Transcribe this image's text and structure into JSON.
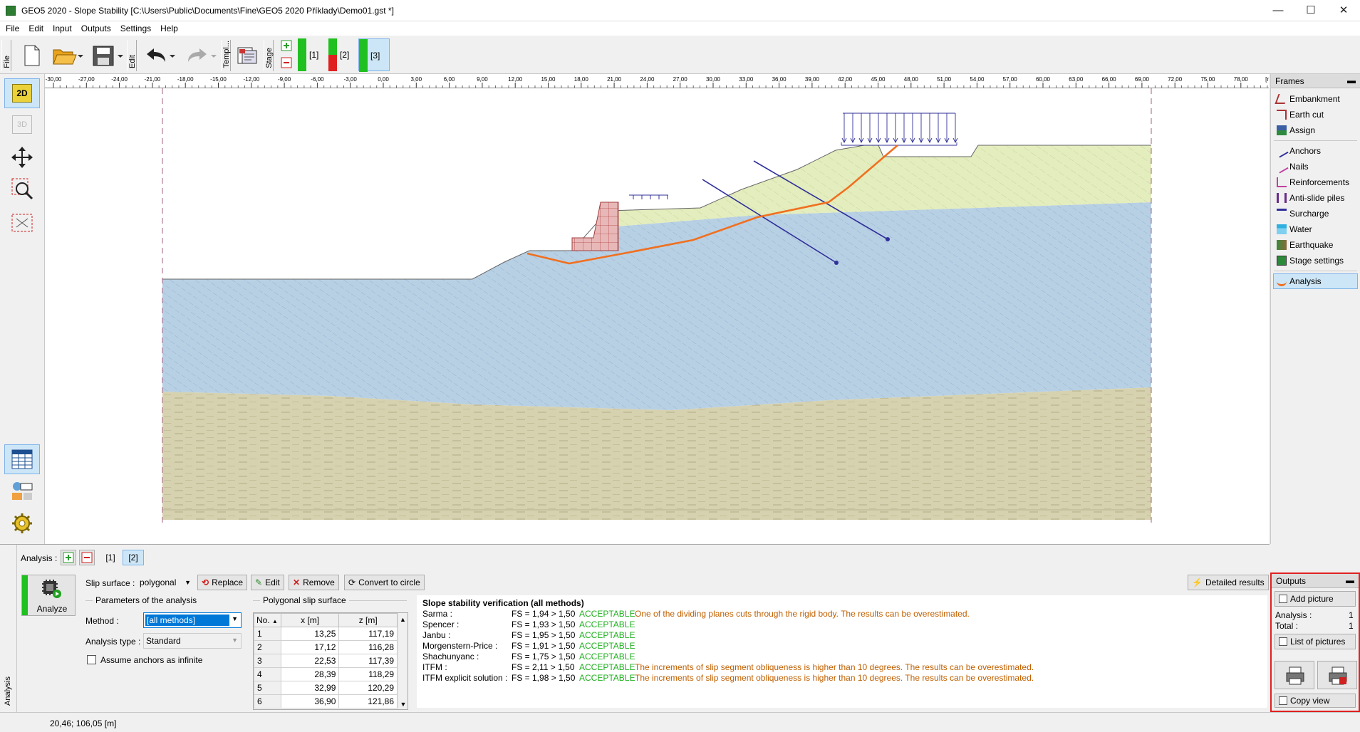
{
  "window": {
    "title": "GEO5 2020 - Slope Stability [C:\\Users\\Public\\Documents\\Fine\\GEO5 2020 Příklady\\Demo01.gst *]",
    "minimize": "—",
    "maximize": "☐",
    "close": "✕"
  },
  "menu": [
    "File",
    "Edit",
    "Input",
    "Outputs",
    "Settings",
    "Help"
  ],
  "toolbar": {
    "file_label": "File",
    "edit_label": "Edit",
    "templ_label": "Templ...",
    "stage_label": "Stage",
    "stages": [
      "[1]",
      "[2]",
      "[3]"
    ]
  },
  "ruler": {
    "unit": "[m]",
    "ticks": [
      "-30,00",
      "-27,00",
      "-24,00",
      "-21,00",
      "-18,00",
      "-15,00",
      "-12,00",
      "-9,00",
      "-6,00",
      "-3,00",
      "0,00",
      "3,00",
      "6,00",
      "9,00",
      "12,00",
      "15,00",
      "18,00",
      "21,00",
      "24,00",
      "27,00",
      "30,00",
      "33,00",
      "36,00",
      "39,00",
      "42,00",
      "45,00",
      "48,00",
      "51,00",
      "54,00",
      "57,00",
      "60,00",
      "63,00",
      "66,00",
      "69,00",
      "72,00",
      "75,00",
      "78,00"
    ]
  },
  "left_tools": {
    "mode_2d": "2D",
    "mode_3d": "3D"
  },
  "frames": {
    "header": "Frames",
    "groups": [
      [
        "Embankment",
        "Earth cut",
        "Assign"
      ],
      [
        "Anchors",
        "Nails",
        "Reinforcements",
        "Anti-slide piles",
        "Surcharge",
        "Water",
        "Earthquake",
        "Stage settings"
      ],
      [
        "Analysis"
      ]
    ]
  },
  "analysis_panel": {
    "side_label": "Analysis",
    "analysis_label": "Analysis :",
    "analyses": [
      "[1]",
      "[2]"
    ],
    "analyze_label": "Analyze",
    "slip_surface_label": "Slip surface :",
    "slip_surface_value": "polygonal",
    "replace": "Replace",
    "edit": "Edit",
    "remove": "Remove",
    "convert": "Convert to circle",
    "detailed_results": "Detailed results",
    "params_header": "Parameters of the analysis",
    "method_label": "Method :",
    "method_value": "[all methods]",
    "analysis_type_label": "Analysis type :",
    "analysis_type_value": "Standard",
    "anchors_infinite": "Assume anchors as infinite",
    "polygon_header": "Polygonal slip surface",
    "table_headers": [
      "No.",
      "x [m]",
      "z [m]"
    ],
    "table_rows": [
      [
        "1",
        "13,25",
        "117,19"
      ],
      [
        "2",
        "17,12",
        "116,28"
      ],
      [
        "3",
        "22,53",
        "117,39"
      ],
      [
        "4",
        "28,39",
        "118,29"
      ],
      [
        "5",
        "32,99",
        "120,29"
      ],
      [
        "6",
        "36,90",
        "121,86"
      ]
    ]
  },
  "results": {
    "title": "Slope stability verification (all methods)",
    "rows": [
      {
        "method": "Sarma :",
        "fs": "FS = 1,94 > 1,50",
        "status": "ACCEPTABLE",
        "note": "One of the dividing planes cuts through the rigid body. The results can be overestimated."
      },
      {
        "method": "Spencer :",
        "fs": "FS = 1,93 > 1,50",
        "status": "ACCEPTABLE",
        "note": ""
      },
      {
        "method": "Janbu :",
        "fs": "FS = 1,95 > 1,50",
        "status": "ACCEPTABLE",
        "note": ""
      },
      {
        "method": "Morgenstern-Price :",
        "fs": "FS = 1,91 > 1,50",
        "status": "ACCEPTABLE",
        "note": ""
      },
      {
        "method": "Shachunyanc :",
        "fs": "FS = 1,75 > 1,50",
        "status": "ACCEPTABLE",
        "note": ""
      },
      {
        "method": "ITFM :",
        "fs": "FS = 2,11 > 1,50",
        "status": "ACCEPTABLE",
        "note": "The increments of slip segment obliqueness is higher than 10 degrees. The results can be overestimated."
      },
      {
        "method": "ITFM explicit solution :",
        "fs": "FS = 1,98 > 1,50",
        "status": "ACCEPTABLE",
        "note": "The increments of slip segment obliqueness is higher than 10 degrees. The results can be overestimated."
      }
    ]
  },
  "outputs": {
    "header": "Outputs",
    "add_picture": "Add picture",
    "analysis_label": "Analysis :",
    "analysis_count": "1",
    "total_label": "Total :",
    "total_count": "1",
    "list_of_pictures": "List of pictures",
    "copy_view": "Copy view"
  },
  "status": {
    "coords": "20,46; 106,05 [m]"
  },
  "colors": {
    "clay": "#b8d0e4",
    "sand": "#e3edbd",
    "bedrock": "#d6d2b0",
    "slip_surface": "#f07020",
    "anchors": "#30309a",
    "wall": "#e8b8b8"
  }
}
